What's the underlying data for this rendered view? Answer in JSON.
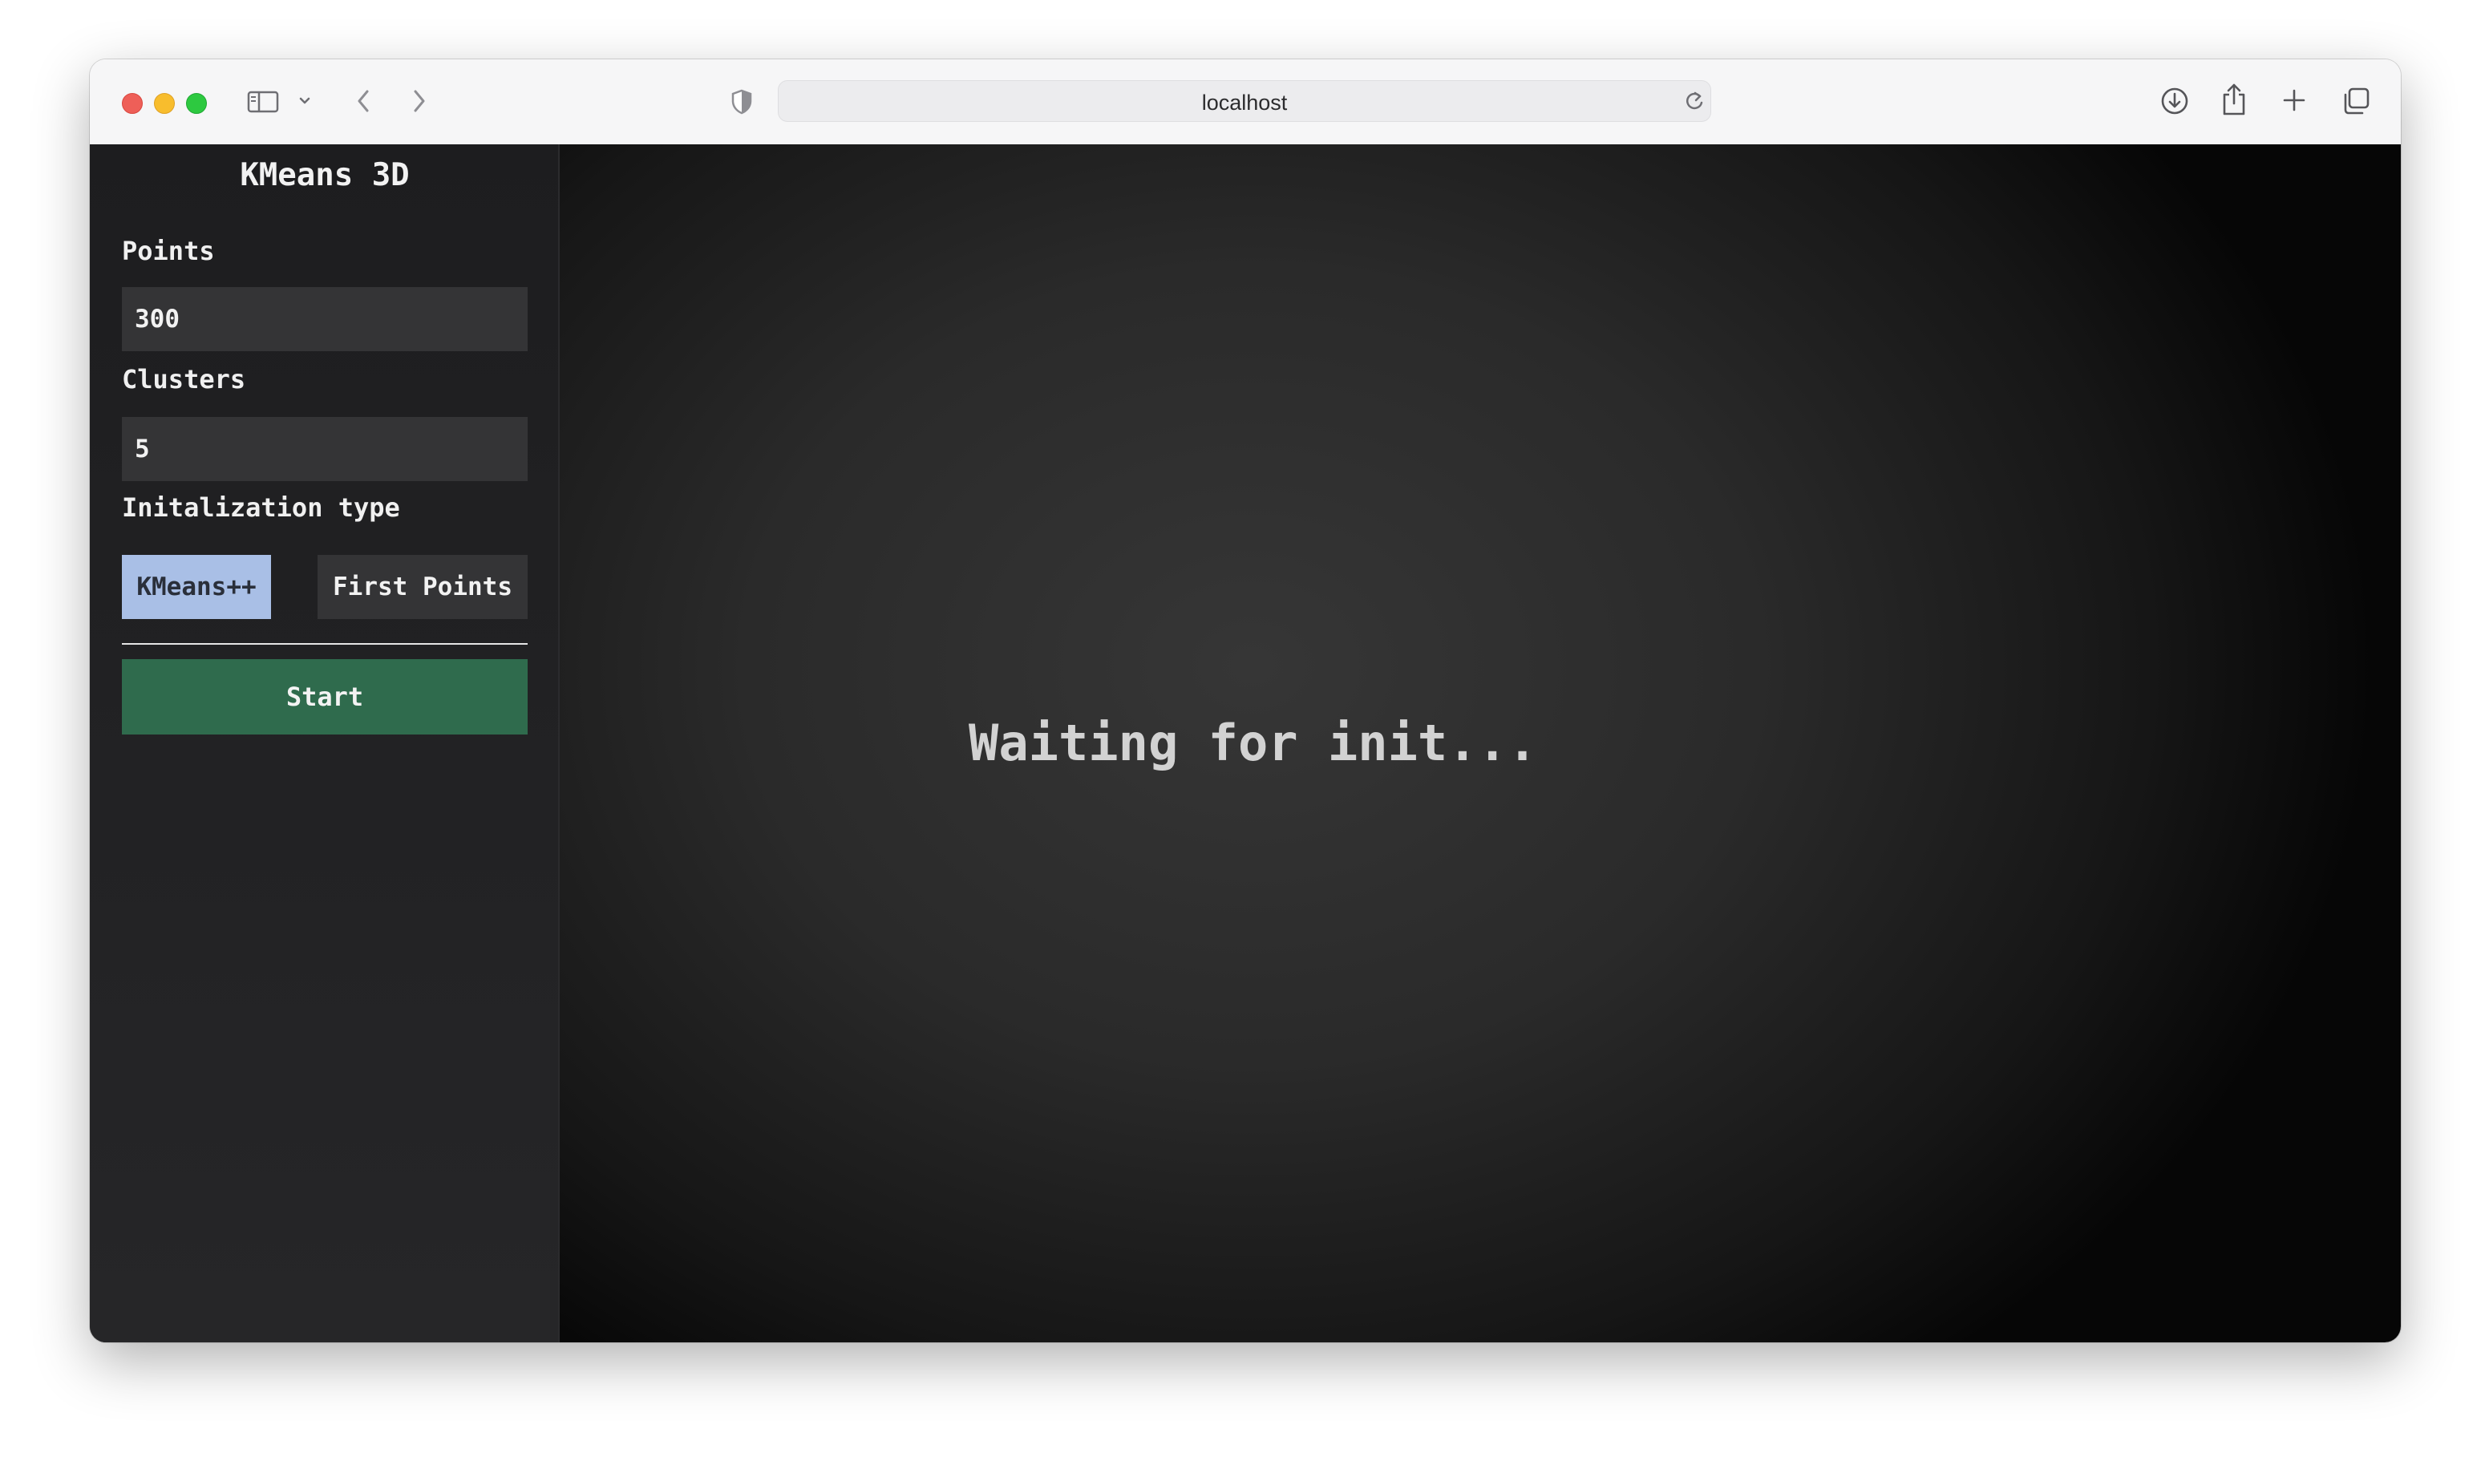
{
  "browser": {
    "address": "localhost",
    "icons": {
      "sidebar_toggle": "sidebar-icon",
      "back": "chevron-left-icon",
      "forward": "chevron-right-icon",
      "privacy": "shield-icon",
      "reload": "reload-icon",
      "downloads": "download-icon",
      "share": "share-icon",
      "new_tab": "plus-icon",
      "tabs": "tab-overview-icon"
    }
  },
  "app": {
    "title": "KMeans 3D",
    "points": {
      "label": "Points",
      "value": "300"
    },
    "clusters": {
      "label": "Clusters",
      "value": "5"
    },
    "init": {
      "label": "Initalization type",
      "options": [
        "KMeans++",
        "First Points"
      ],
      "selected": "KMeans++"
    },
    "start_label": "Start",
    "status": "Waiting for init..."
  },
  "colors": {
    "selected_option": "#a9bfe6",
    "start_button": "#2f6b4d",
    "sidebar_bg": "#1f1f21",
    "input_bg": "#343436"
  }
}
